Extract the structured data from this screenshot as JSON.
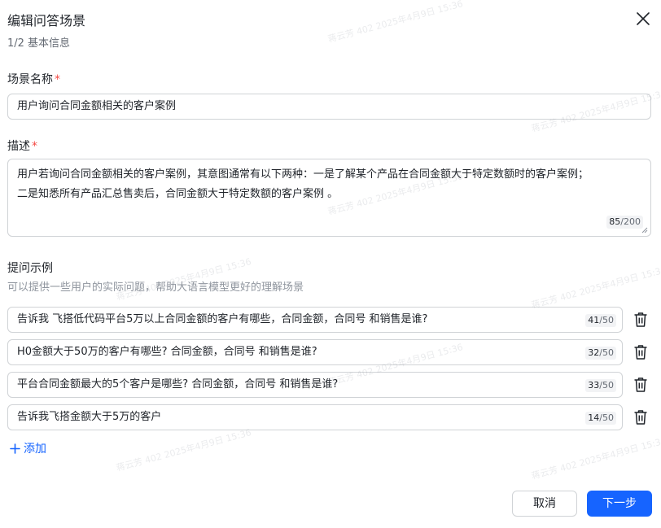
{
  "dialog": {
    "title": "编辑问答场景",
    "step": "1/2 基本信息"
  },
  "scene_name": {
    "label": "场景名称",
    "required_mark": "*",
    "value": "用户询问合同金额相关的客户案例"
  },
  "description": {
    "label": "描述",
    "required_mark": "*",
    "line1": "用户若询问合同金额相关的客户案例，其意图通常有以下两种：一是了解某个产品在合同金额大于特定数额时的客户案例；",
    "line2": "二是知悉所有产品汇总售卖后，合同金额大于特定数额的客户案例 。",
    "count": "85",
    "max": "/200"
  },
  "examples": {
    "label": "提问示例",
    "hint": "可以提供一些用户的实际问题，帮助大语言模型更好的理解场景",
    "items": [
      {
        "value": "告诉我 飞搭低代码平台5万以上合同金额的客户有哪些，合同金额，合同号 和销售是谁?",
        "count": "41",
        "max": "/50"
      },
      {
        "value": "H0金额大于50万的客户有哪些? 合同金额，合同号  和销售是谁?",
        "count": "32",
        "max": "/50"
      },
      {
        "value": "平台合同金额最大的5个客户是哪些? 合同金额，合同号  和销售是谁?",
        "count": "33",
        "max": "/50"
      },
      {
        "value": "告诉我飞搭金额大于5万的客户",
        "count": "14",
        "max": "/50"
      }
    ],
    "add_label": "添加"
  },
  "footer": {
    "cancel_label": "取消",
    "next_label": "下一步"
  },
  "watermark": {
    "text": "蒋云芳 402 2025年4月9日 15:36"
  },
  "colors": {
    "primary": "#1664ff",
    "required": "#f54a45",
    "border": "#d0d3d6"
  }
}
